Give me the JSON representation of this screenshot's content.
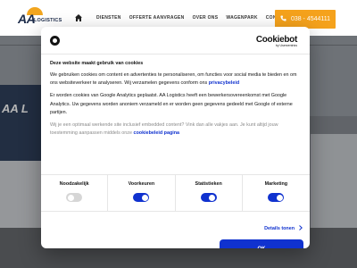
{
  "header": {
    "logo_aa": "AA",
    "logo_text": "LOGISTICS",
    "nav": [
      "DIENSTEN",
      "OFFERTE AANVRAGEN",
      "OVER ONS",
      "WAGENPARK",
      "CONTACT"
    ],
    "phone": "038 - 4544111"
  },
  "hero": {
    "sign_text": "AA L"
  },
  "cookie": {
    "brand": "Cookiebot",
    "brand_by": "by Usercentrics",
    "title": "Deze website maakt gebruik van cookies",
    "para1": "We gebruiken cookies om content en advertenties te personaliseren, om functies voor social media te bieden en om ons websiteverkeer te analyseren. Wij verzamelen gegevens conform ons",
    "para1_link": "privacybeleid",
    "para2": "Er worden cookies van Google Analytics geplaatst. AA Logistics heeft een bewerkersovereenkomst met Google Analytics. Uw gegevens worden anoniem verzameld en er worden geen gegevens gedeeld met Google of externe partijen.",
    "para3": "Wij je een optimaal werkende site inclusief embedded content? Vink dan alle vakjes aan. Je kunt altijd jouw toestemming aanpassen middels onze",
    "para3_link": "cookiebeleid pagina",
    "toggles": [
      {
        "label": "Noodzakelijk",
        "on": false
      },
      {
        "label": "Voorkeuren",
        "on": true
      },
      {
        "label": "Statistieken",
        "on": true
      },
      {
        "label": "Marketing",
        "on": true
      }
    ],
    "details_label": "Details tonen",
    "ok_label": "OK"
  },
  "colors": {
    "accent_orange": "#f5a21c",
    "cookiebot_blue": "#1032cf",
    "navy": "#1b2a49"
  }
}
